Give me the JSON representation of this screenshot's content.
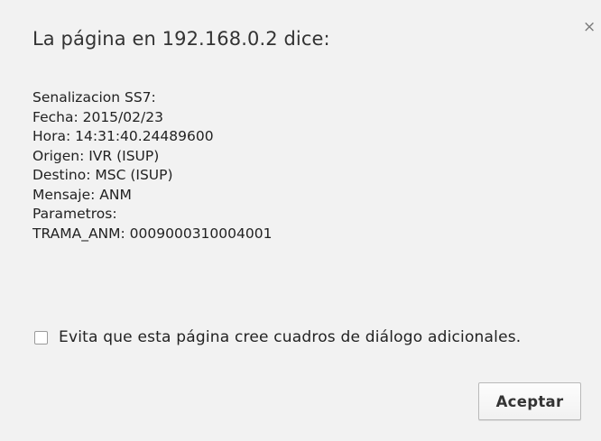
{
  "dialog": {
    "title": "La página en 192.168.0.2 dice:",
    "close_symbol": "×",
    "message_lines": [
      "Senalizacion SS7:",
      "Fecha: 2015/02/23",
      "Hora: 14:31:40.24489600",
      "Origen: IVR (ISUP)",
      "Destino: MSC (ISUP)",
      "Mensaje: ANM",
      "Parametros:",
      "TRAMA_ANM: 0009000310004001"
    ],
    "suppress_checkbox": {
      "label": "Evita que esta página cree cuadros de diálogo adicionales.",
      "checked": false
    },
    "accept_label": "Aceptar"
  }
}
